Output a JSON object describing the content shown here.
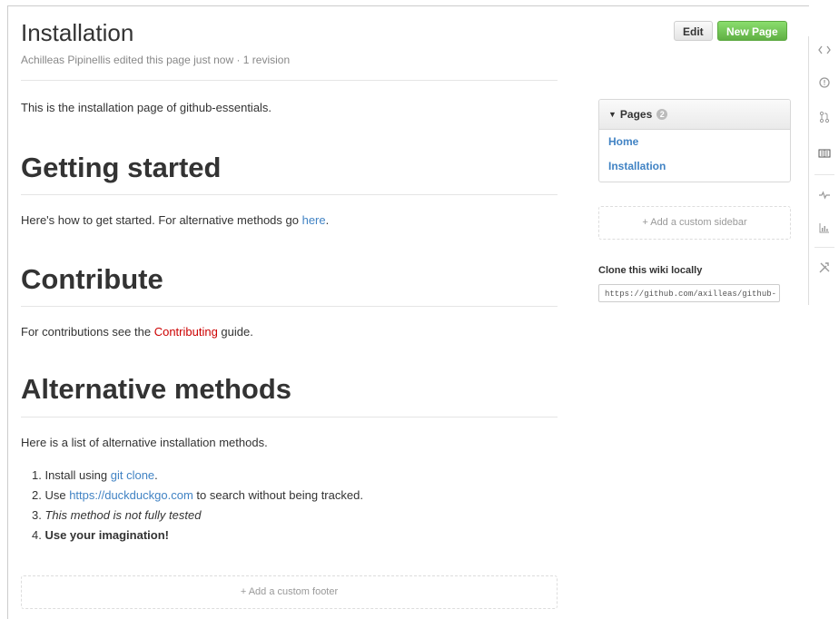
{
  "header": {
    "title": "Installation",
    "meta": "Achilleas Pipinellis edited this page just now · 1 revision",
    "edit_label": "Edit",
    "new_page_label": "New Page"
  },
  "content": {
    "intro": "This is the installation page of github-essentials.",
    "getting_started": {
      "heading": "Getting started",
      "text_before": "Here's how to get started. For alternative methods go ",
      "link": "here",
      "text_after": "."
    },
    "contribute": {
      "heading": "Contribute",
      "text_before": "For contributions see the ",
      "link": "Contributing",
      "text_after": " guide."
    },
    "alternative": {
      "heading": "Alternative methods",
      "intro": "Here is a list of alternative installation methods.",
      "items": [
        {
          "num": "1.",
          "before": "Install using ",
          "link": "git clone",
          "after": "."
        },
        {
          "num": "2.",
          "before": "Use ",
          "link": "https://duckduckgo.com",
          "after": " to search without being tracked."
        },
        {
          "num": "3.",
          "text": "This method is not fully tested"
        },
        {
          "num": "4.",
          "text": "Use your imagination!"
        }
      ]
    },
    "footer_add": "+ Add a custom footer"
  },
  "sidebar": {
    "pages_title": "Pages",
    "pages_count": "2",
    "pages": [
      "Home",
      "Installation"
    ],
    "add_sidebar": "+ Add a custom sidebar",
    "clone_label": "Clone this wiki locally",
    "clone_url": "https://github.com/axilleas/github-"
  },
  "rail_icons": [
    "code-icon",
    "issues-icon",
    "pull-request-icon",
    "wiki-icon",
    "pulse-icon",
    "graphs-icon",
    "settings-icon"
  ],
  "colors": {
    "accent": "#4183c4",
    "new_page_green": "#60b044",
    "missing_link": "#cc0000",
    "active_tab": "#d26911"
  }
}
